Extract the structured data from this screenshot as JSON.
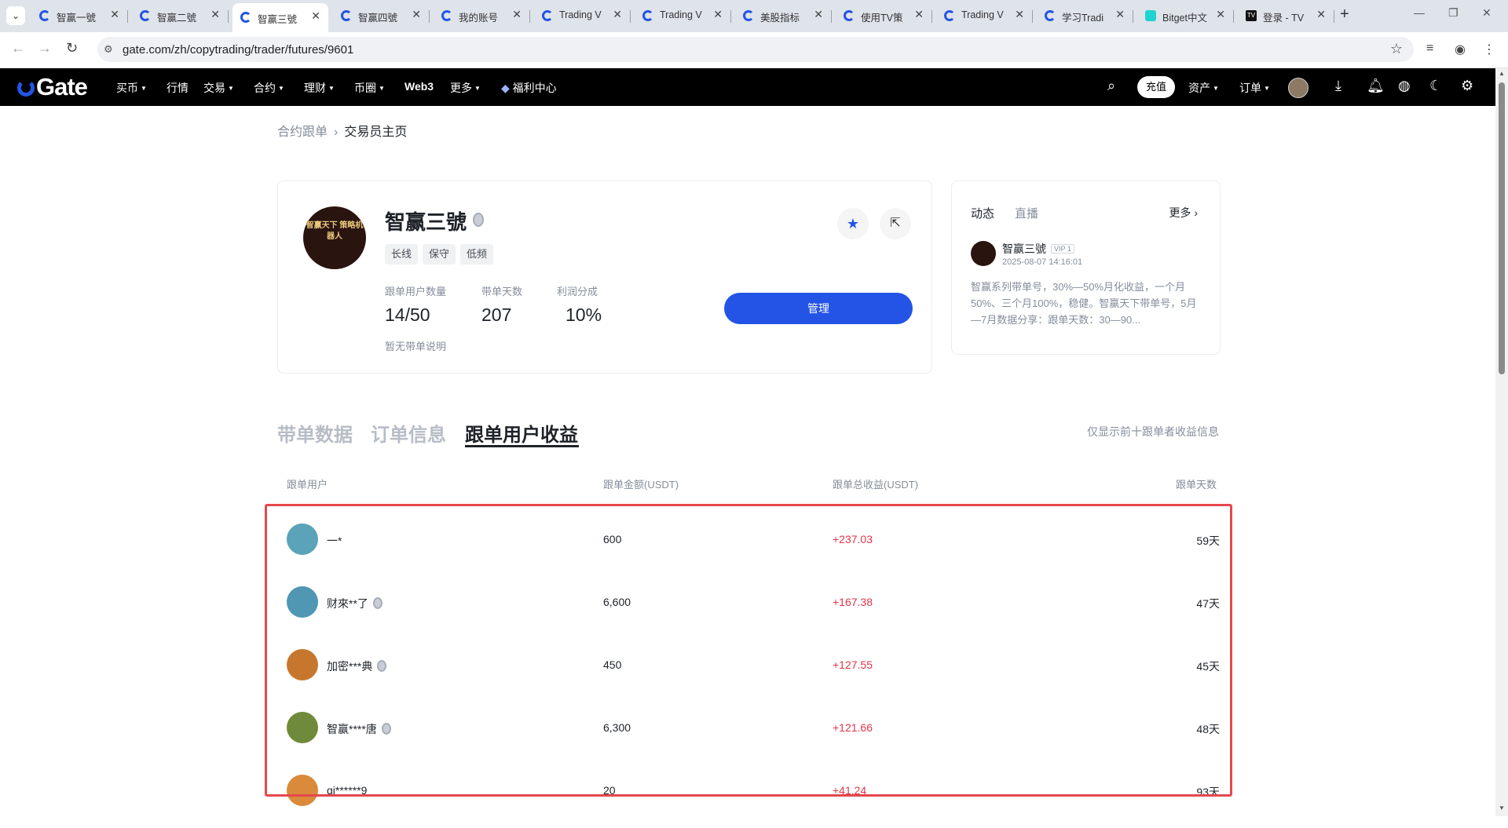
{
  "browser": {
    "tabs": [
      {
        "title": "智赢一號",
        "icon": "gate"
      },
      {
        "title": "智赢二號",
        "icon": "gate"
      },
      {
        "title": "智赢三號",
        "icon": "gate",
        "active": true
      },
      {
        "title": "智赢四號",
        "icon": "gate"
      },
      {
        "title": "我的账号",
        "icon": "gate"
      },
      {
        "title": "Trading V",
        "icon": "gate"
      },
      {
        "title": "Trading V",
        "icon": "gate"
      },
      {
        "title": "美股指标",
        "icon": "gate"
      },
      {
        "title": "使用TV策",
        "icon": "gate"
      },
      {
        "title": "Trading V",
        "icon": "gate"
      },
      {
        "title": "学习Tradi",
        "icon": "gate"
      },
      {
        "title": "Bitget中文",
        "icon": "bitget"
      },
      {
        "title": "登录 - TV",
        "icon": "tv"
      }
    ],
    "url": "gate.com/zh/copytrading/trader/futures/9601"
  },
  "header": {
    "logo": "Gate",
    "nav": [
      {
        "label": "买币",
        "dropdown": true
      },
      {
        "label": "行情",
        "dropdown": false
      },
      {
        "label": "交易",
        "dropdown": true
      },
      {
        "label": "合约",
        "dropdown": true
      },
      {
        "label": "理财",
        "dropdown": true
      },
      {
        "label": "币圈",
        "dropdown": true
      },
      {
        "label": "Web3",
        "dropdown": false,
        "bold": true
      },
      {
        "label": "更多",
        "dropdown": true
      },
      {
        "label": "福利中心",
        "dropdown": false
      }
    ],
    "recharge_label": "充值",
    "assets_label": "资产",
    "orders_label": "订单"
  },
  "breadcrumb": {
    "parent": "合约跟单",
    "current": "交易员主页"
  },
  "trader": {
    "avatar_text": "智赢天下 策略机器人",
    "name": "智赢三號",
    "tags": [
      "长线",
      "保守",
      "低频"
    ],
    "stats": [
      {
        "label": "跟单用户数量",
        "value": "14/50"
      },
      {
        "label": "带单天数",
        "value": "207"
      },
      {
        "label": "利润分成",
        "value": "10%"
      }
    ],
    "no_desc": "暂无带单说明",
    "manage_label": "管理"
  },
  "feed": {
    "tab_dynamic": "动态",
    "tab_live": "直播",
    "more_label": "更多",
    "post": {
      "author": "智赢三號",
      "vip": "VIP 1",
      "time": "2025-08-07 14:16:01",
      "body": "智赢系列带单号，30%—50%月化收益，一个月50%、三个月100%，稳健。智赢天下带单号，5月—7月数据分享：跟单天数：30—90..."
    }
  },
  "sections": {
    "tabs": [
      "带单数据",
      "订单信息",
      "跟单用户收益"
    ],
    "active_index": 2,
    "note": "仅显示前十跟单者收益信息"
  },
  "table": {
    "headers": [
      "跟单用户",
      "跟单金额(USDT)",
      "跟单总收益(USDT)",
      "跟单天数"
    ],
    "rows": [
      {
        "user": "一*",
        "medal": false,
        "amount": "600",
        "pnl": "+237.03",
        "days": "59天",
        "avatar_color": "#5aa3b8"
      },
      {
        "user": "财來**了",
        "medal": true,
        "amount": "6,600",
        "pnl": "+167.38",
        "days": "47天",
        "avatar_color": "#4f97b3"
      },
      {
        "user": "加密***典",
        "medal": true,
        "amount": "450",
        "pnl": "+127.55",
        "days": "45天",
        "avatar_color": "#c7762d"
      },
      {
        "user": "智赢****唐",
        "medal": true,
        "amount": "6,300",
        "pnl": "+121.66",
        "days": "48天",
        "avatar_color": "#6f8a3a"
      },
      {
        "user": "qi******9",
        "medal": false,
        "amount": "20",
        "pnl": "+41.24",
        "days": "93天",
        "avatar_color": "#d98a3a"
      }
    ]
  },
  "colors": {
    "accent": "#2354e6",
    "profit": "#e0364a",
    "highlight_box": "#e5484d"
  }
}
